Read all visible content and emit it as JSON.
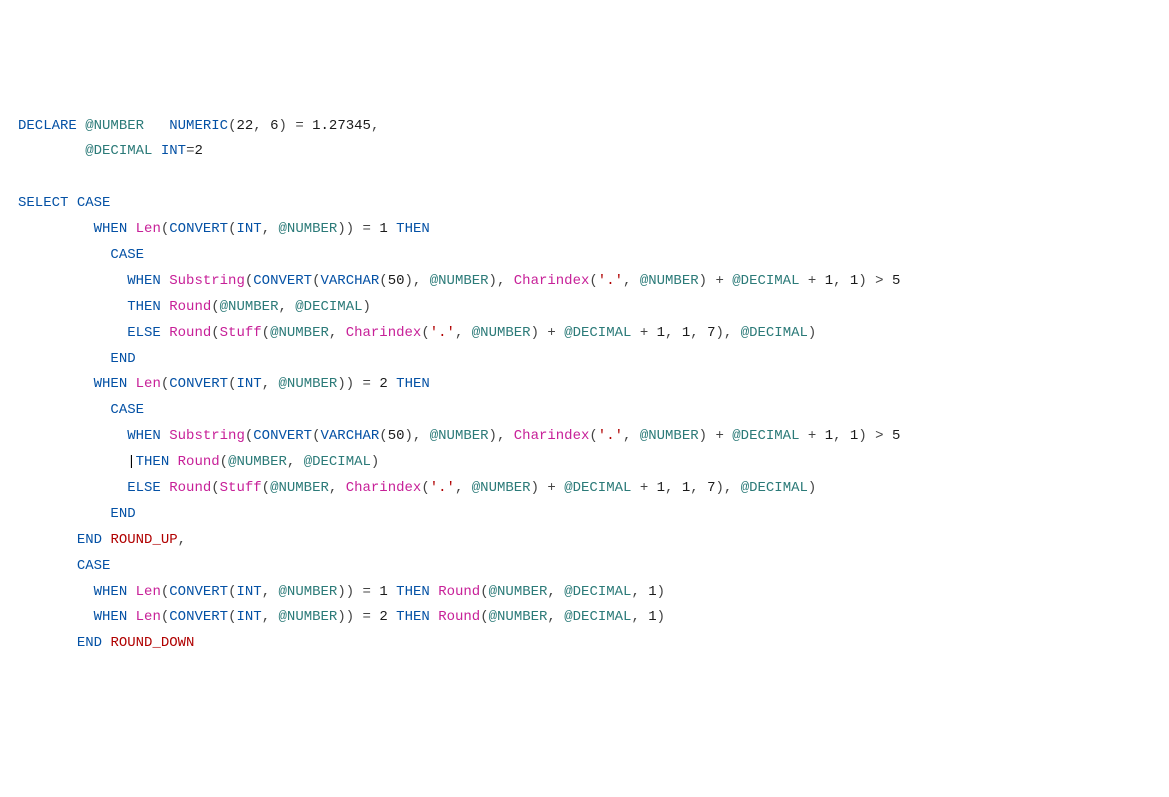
{
  "code": {
    "l1": {
      "t1": "DECLARE",
      "t2": "@NUMBER",
      "t3": "NUMERIC",
      "t4": "(",
      "t5": "22",
      "t6": ",",
      "t7": "6",
      "t8": ")",
      "t9": "=",
      "t10": "1.27345",
      "t11": ","
    },
    "l2": {
      "t1": "@DECIMAL",
      "t2": "INT",
      "t3": "=",
      "t4": "2"
    },
    "l3": {
      "blank": ""
    },
    "l4": {
      "t1": "SELECT",
      "t2": "CASE"
    },
    "l5": {
      "t1": "WHEN",
      "t2": "Len",
      "t3": "(",
      "t4": "CONVERT",
      "t5": "(",
      "t6": "INT",
      "t7": ",",
      "t8": "@NUMBER",
      "t9": ")",
      "t10": ")",
      "t11": "=",
      "t12": "1",
      "t13": "THEN"
    },
    "l6": {
      "t1": "CASE"
    },
    "l7": {
      "t1": "WHEN",
      "t2": "Substring",
      "t3": "(",
      "t4": "CONVERT",
      "t5": "(",
      "t6": "VARCHAR",
      "t7": "(",
      "t8": "50",
      "t9": ")",
      "t10": ",",
      "t11": "@NUMBER",
      "t12": ")",
      "t13": ",",
      "t14": "Charindex",
      "t15": "(",
      "t16": "'.'",
      "t17": ",",
      "t18": "@NUMBER",
      "t19": ")",
      "t20": "+",
      "t21": "@DECIMAL",
      "t22": "+",
      "t23": "1",
      "t24": ",",
      "t25": "1",
      "t26": ")",
      "t27": ">",
      "t28": "5"
    },
    "l8": {
      "t1": "THEN",
      "t2": "Round",
      "t3": "(",
      "t4": "@NUMBER",
      "t5": ",",
      "t6": "@DECIMAL",
      "t7": ")"
    },
    "l9": {
      "t1": "ELSE",
      "t2": "Round",
      "t3": "(",
      "t4": "Stuff",
      "t5": "(",
      "t6": "@NUMBER",
      "t7": ",",
      "t8": "Charindex",
      "t9": "(",
      "t10": "'.'",
      "t11": ",",
      "t12": "@NUMBER",
      "t13": ")",
      "t14": "+",
      "t15": "@DECIMAL",
      "t16": "+",
      "t17": "1",
      "t18": ",",
      "t19": "1",
      "t20": ",",
      "t21": "7",
      "t22": ")",
      "t23": ",",
      "t24": "@DECIMAL",
      "t25": ")"
    },
    "l10": {
      "t1": "END"
    },
    "l11": {
      "t1": "WHEN",
      "t2": "Len",
      "t3": "(",
      "t4": "CONVERT",
      "t5": "(",
      "t6": "INT",
      "t7": ",",
      "t8": "@NUMBER",
      "t9": ")",
      "t10": ")",
      "t11": "=",
      "t12": "2",
      "t13": "THEN"
    },
    "l12": {
      "t1": "CASE"
    },
    "l13": {
      "t1": "WHEN",
      "t2": "Substring",
      "t3": "(",
      "t4": "CONVERT",
      "t5": "(",
      "t6": "VARCHAR",
      "t7": "(",
      "t8": "50",
      "t9": ")",
      "t10": ",",
      "t11": "@NUMBER",
      "t12": ")",
      "t13": ",",
      "t14": "Charindex",
      "t15": "(",
      "t16": "'.'",
      "t17": ",",
      "t18": "@NUMBER",
      "t19": ")",
      "t20": "+",
      "t21": "@DECIMAL",
      "t22": "+",
      "t23": "1",
      "t24": ",",
      "t25": "1",
      "t26": ")",
      "t27": ">",
      "t28": "5"
    },
    "l14": {
      "caret": "|",
      "t1": "THEN",
      "t2": "Round",
      "t3": "(",
      "t4": "@NUMBER",
      "t5": ",",
      "t6": "@DECIMAL",
      "t7": ")"
    },
    "l15": {
      "t1": "ELSE",
      "t2": "Round",
      "t3": "(",
      "t4": "Stuff",
      "t5": "(",
      "t6": "@NUMBER",
      "t7": ",",
      "t8": "Charindex",
      "t9": "(",
      "t10": "'.'",
      "t11": ",",
      "t12": "@NUMBER",
      "t13": ")",
      "t14": "+",
      "t15": "@DECIMAL",
      "t16": "+",
      "t17": "1",
      "t18": ",",
      "t19": "1",
      "t20": ",",
      "t21": "7",
      "t22": ")",
      "t23": ",",
      "t24": "@DECIMAL",
      "t25": ")"
    },
    "l16": {
      "t1": "END"
    },
    "l17": {
      "t1": "END",
      "t2": "ROUND_UP",
      "t3": ","
    },
    "l18": {
      "t1": "CASE"
    },
    "l19": {
      "t1": "WHEN",
      "t2": "Len",
      "t3": "(",
      "t4": "CONVERT",
      "t5": "(",
      "t6": "INT",
      "t7": ",",
      "t8": "@NUMBER",
      "t9": ")",
      "t10": ")",
      "t11": "=",
      "t12": "1",
      "t13": "THEN",
      "t14": "Round",
      "t15": "(",
      "t16": "@NUMBER",
      "t17": ",",
      "t18": "@DECIMAL",
      "t19": ",",
      "t20": "1",
      "t21": ")"
    },
    "l20": {
      "t1": "WHEN",
      "t2": "Len",
      "t3": "(",
      "t4": "CONVERT",
      "t5": "(",
      "t6": "INT",
      "t7": ",",
      "t8": "@NUMBER",
      "t9": ")",
      "t10": ")",
      "t11": "=",
      "t12": "2",
      "t13": "THEN",
      "t14": "Round",
      "t15": "(",
      "t16": "@NUMBER",
      "t17": ",",
      "t18": "@DECIMAL",
      "t19": ",",
      "t20": "1",
      "t21": ")"
    },
    "l21": {
      "t1": "END",
      "t2": "ROUND_DOWN"
    }
  }
}
